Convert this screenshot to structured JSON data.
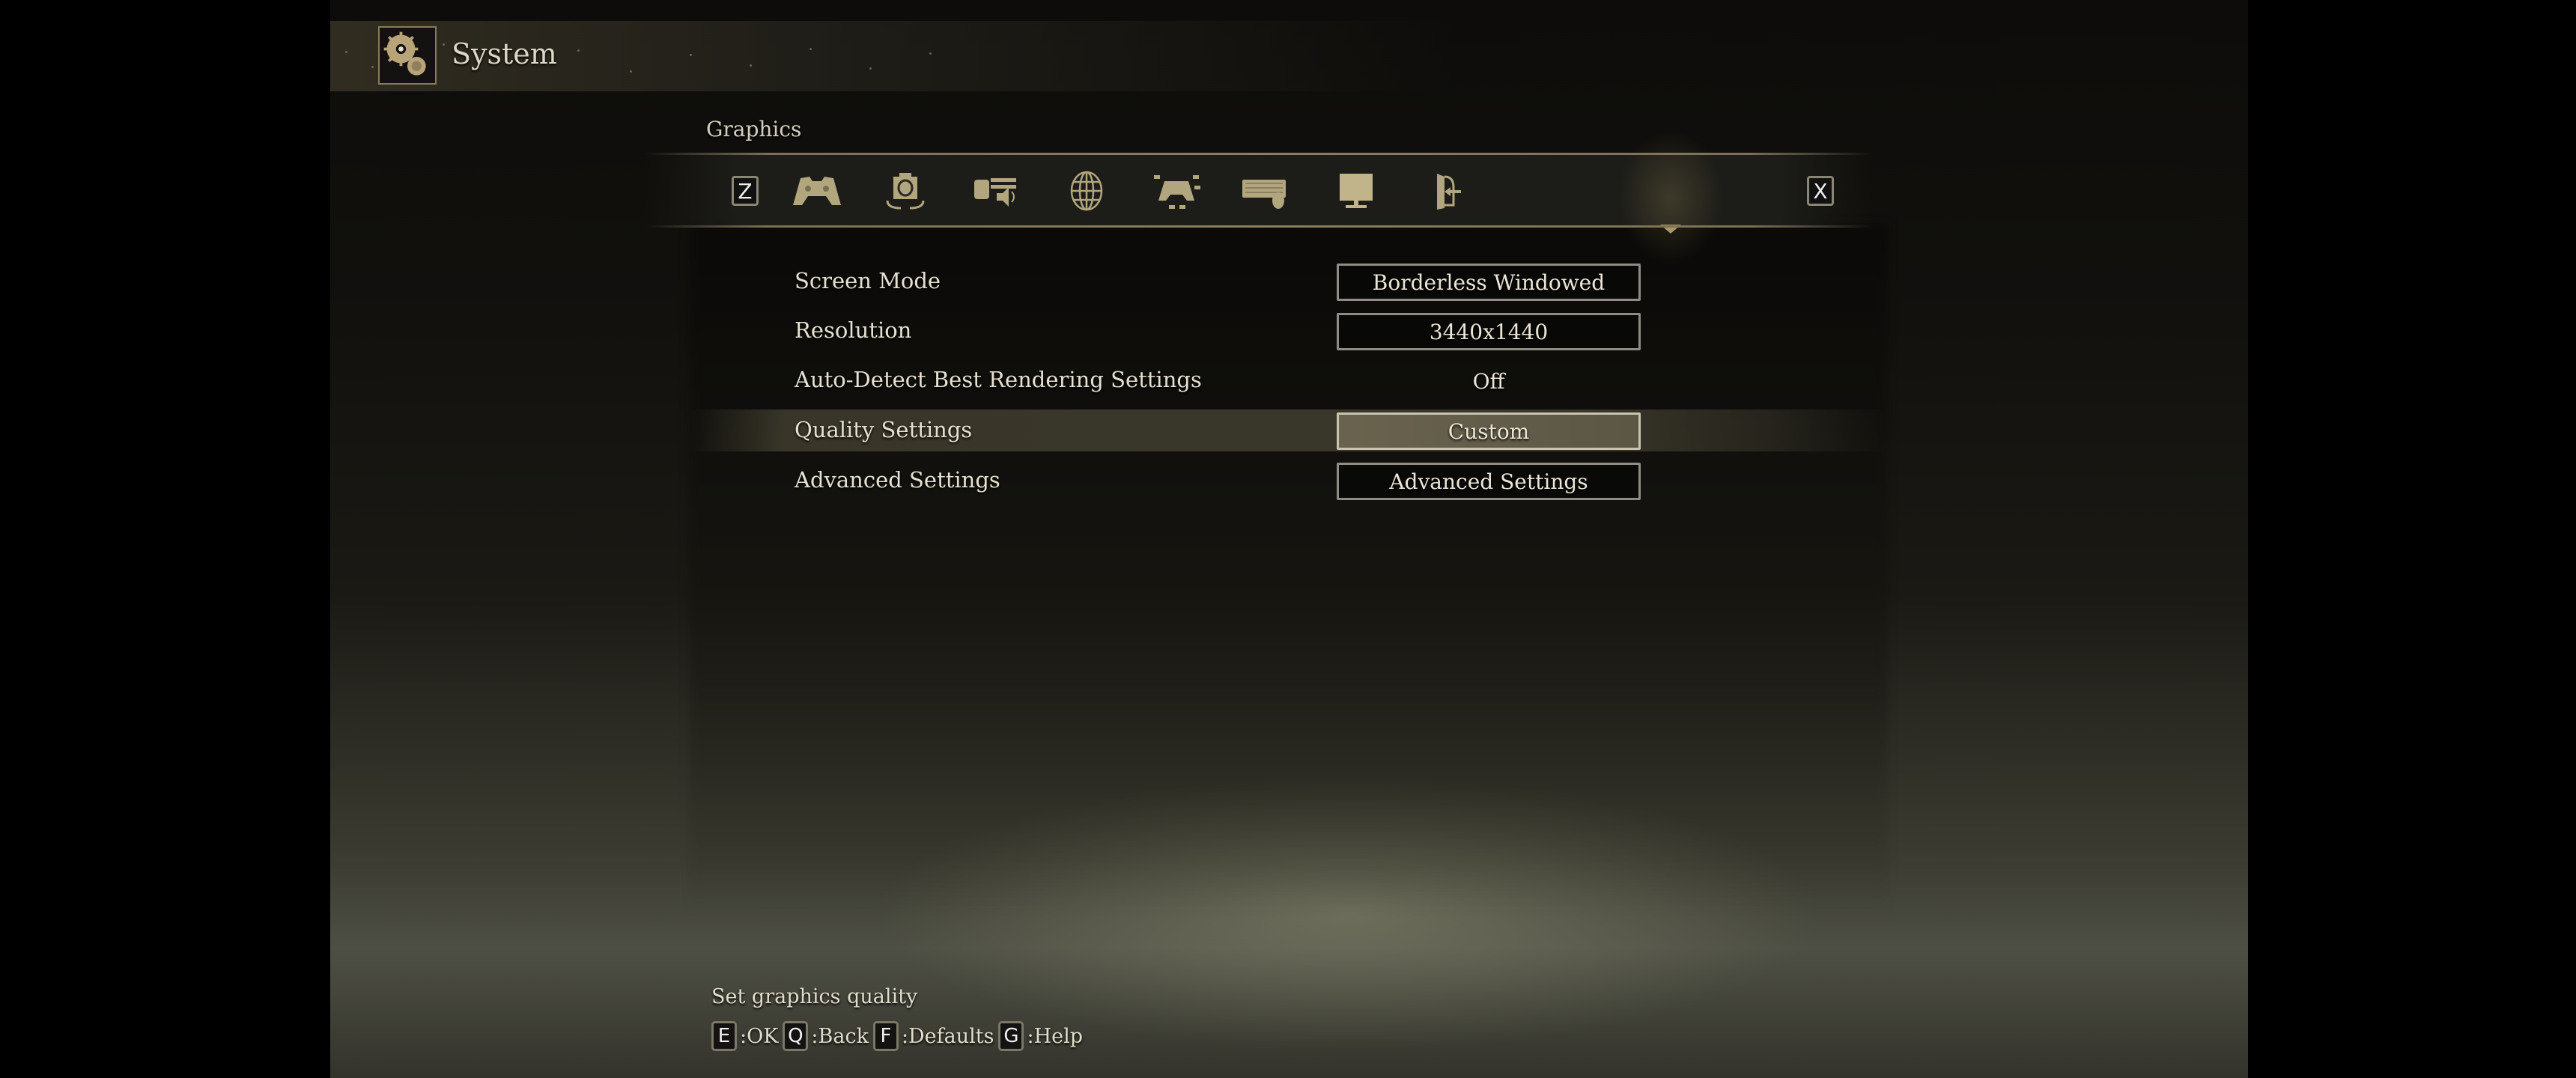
{
  "header": {
    "title": "System",
    "icon": "gears-icon"
  },
  "tabs": {
    "heading": "Graphics",
    "prev_key": "Z",
    "next_key": "X",
    "items": [
      {
        "name": "Game",
        "icon": "gamepad-icon",
        "active": false
      },
      {
        "name": "Camera",
        "icon": "camera-icon",
        "active": false
      },
      {
        "name": "Sound",
        "icon": "sound-icon",
        "active": false
      },
      {
        "name": "Network",
        "icon": "globe-icon",
        "active": false
      },
      {
        "name": "Controls",
        "icon": "controller-mapping-icon",
        "active": false
      },
      {
        "name": "Keyboard",
        "icon": "keyboard-mouse-icon",
        "active": false
      },
      {
        "name": "Graphics",
        "icon": "monitor-icon",
        "active": true
      },
      {
        "name": "Quit",
        "icon": "exit-door-icon",
        "active": false
      }
    ]
  },
  "settings": [
    {
      "label": "Screen Mode",
      "value": "Borderless Windowed",
      "boxed": true,
      "selected": false
    },
    {
      "label": "Resolution",
      "value": "3440x1440",
      "boxed": true,
      "selected": false
    },
    {
      "label": "Auto-Detect Best Rendering Settings",
      "value": "Off",
      "boxed": false,
      "selected": false
    },
    {
      "label": "Quality Settings",
      "value": "Custom",
      "boxed": true,
      "selected": true
    },
    {
      "label": "Advanced Settings",
      "value": "Advanced Settings",
      "boxed": true,
      "selected": false
    }
  ],
  "footer": {
    "help_text": "Set graphics quality",
    "controls": [
      {
        "key": "E",
        "label": ":OK"
      },
      {
        "key": "Q",
        "label": ":Back"
      },
      {
        "key": "F",
        "label": ":Defaults"
      },
      {
        "key": "G",
        "label": ":Help"
      }
    ]
  },
  "colors": {
    "accent_gold": "#a8976c",
    "text": "#e6e0d0",
    "icon_fill": "#b2a67e"
  }
}
